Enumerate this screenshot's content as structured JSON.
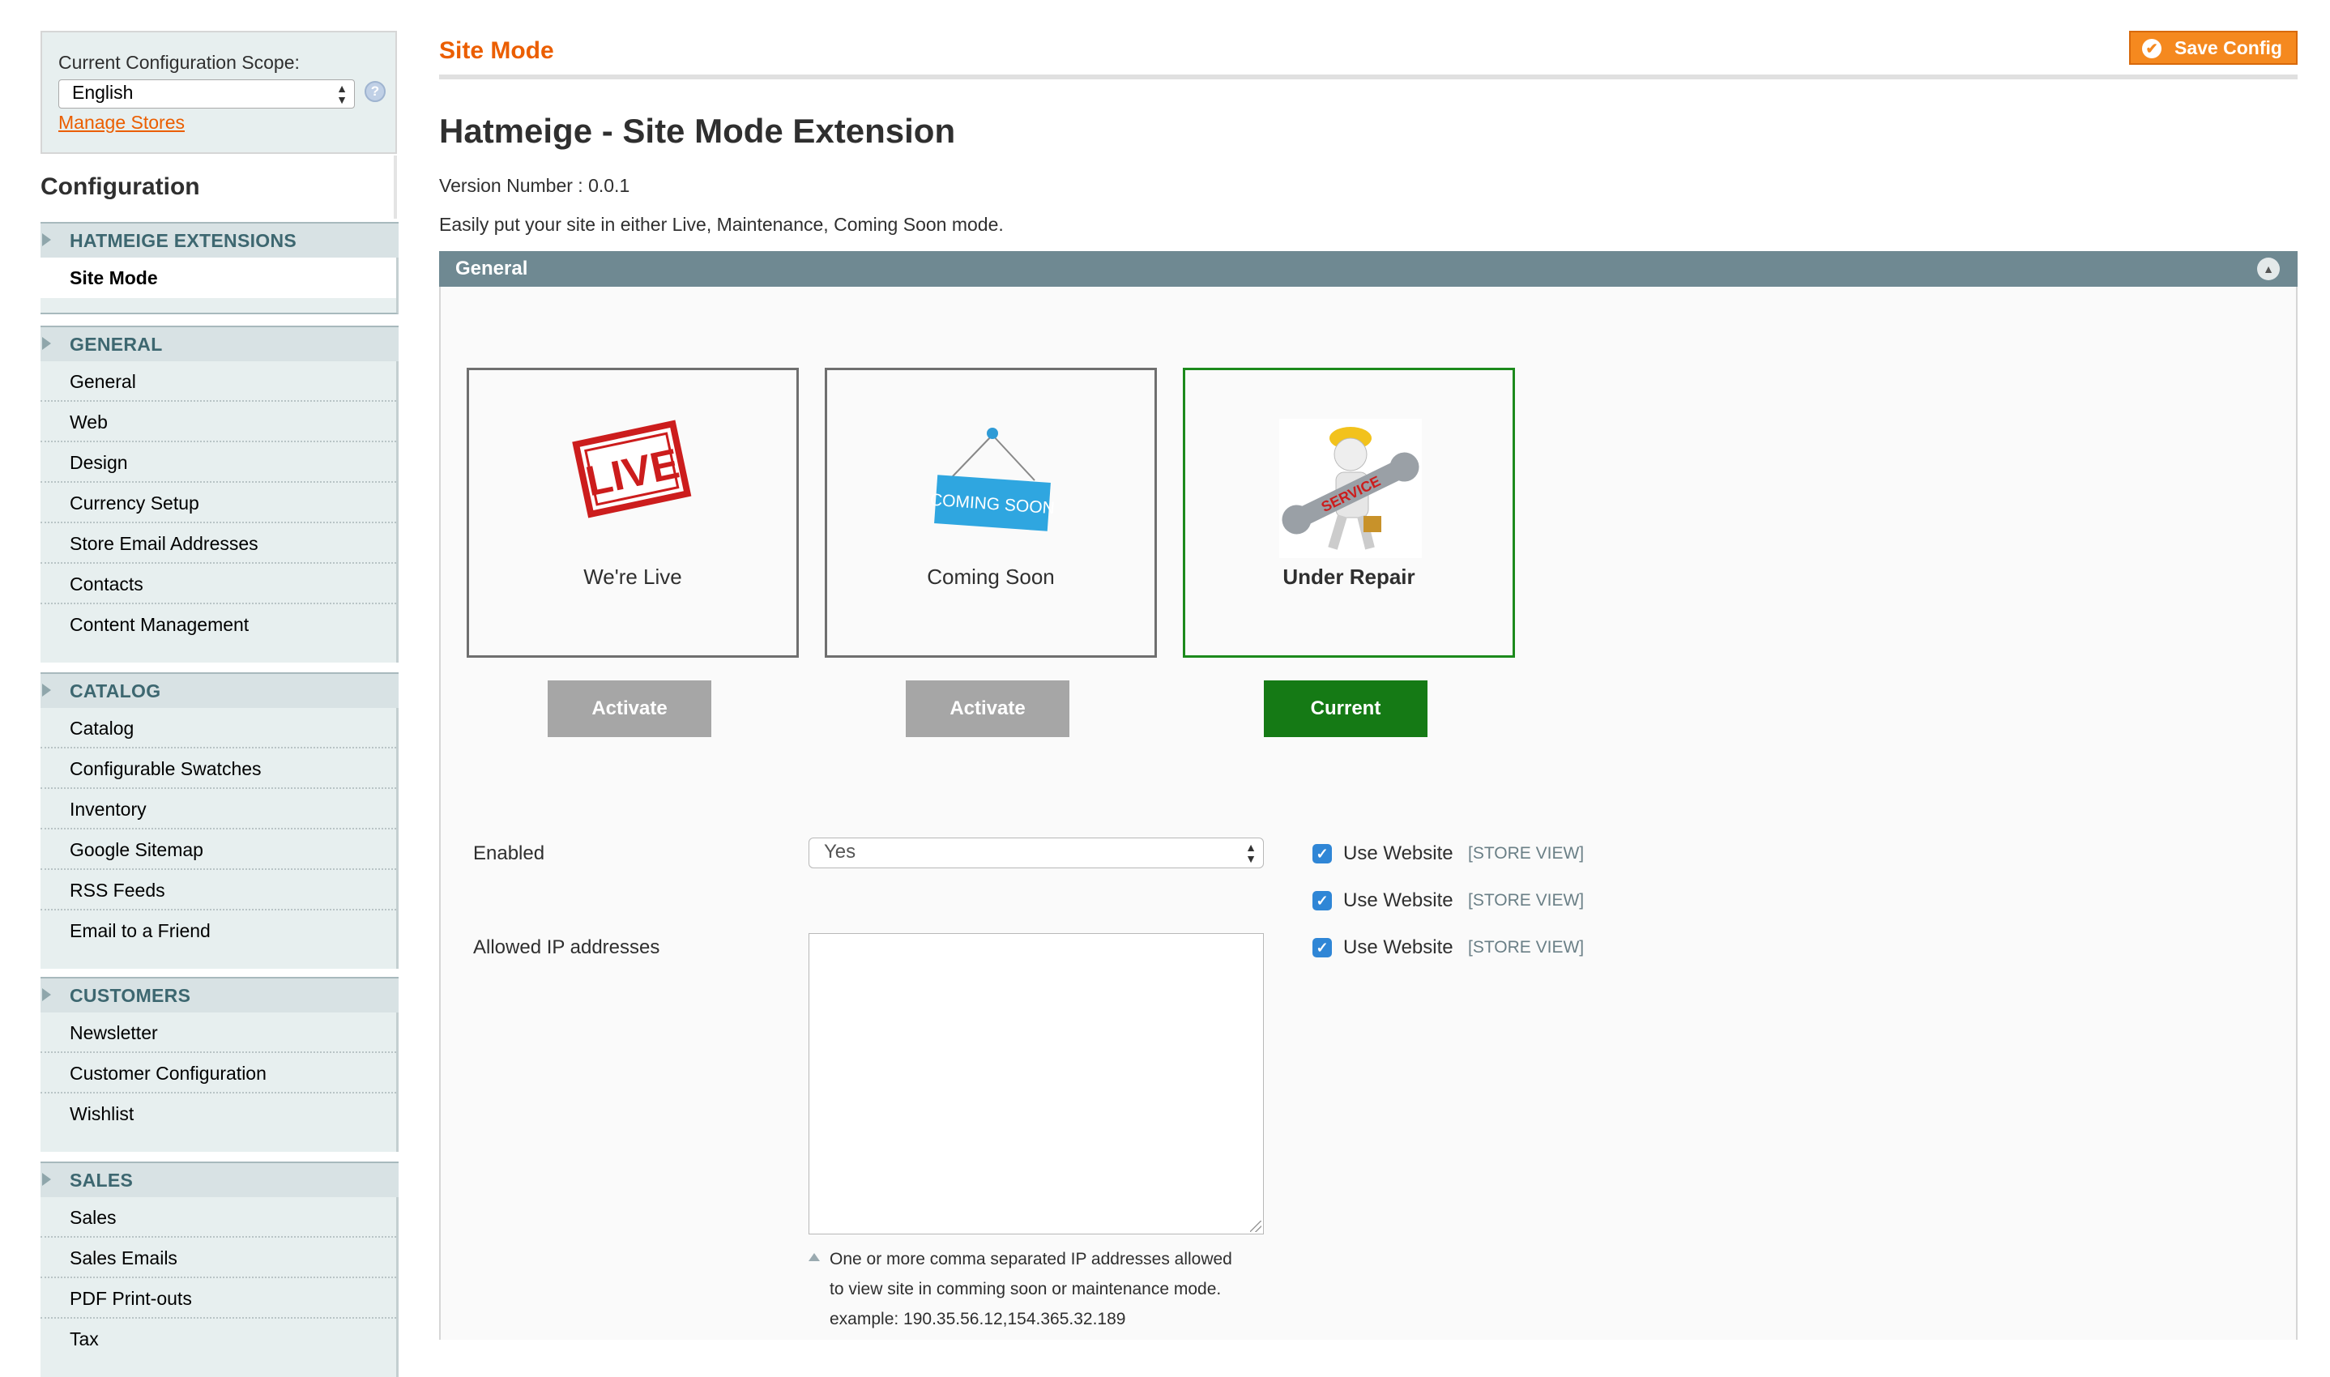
{
  "sidebar": {
    "scope_label": "Current Configuration Scope:",
    "scope_value": "English",
    "manage_stores": "Manage Stores",
    "config_title": "Configuration",
    "groups": [
      {
        "title": "HATMEIGE EXTENSIONS",
        "items": [
          "Site Mode"
        ],
        "active": 0
      },
      {
        "title": "GENERAL",
        "items": [
          "General",
          "Web",
          "Design",
          "Currency Setup",
          "Store Email Addresses",
          "Contacts",
          "Content Management"
        ]
      },
      {
        "title": "CATALOG",
        "items": [
          "Catalog",
          "Configurable Swatches",
          "Inventory",
          "Google Sitemap",
          "RSS Feeds",
          "Email to a Friend"
        ]
      },
      {
        "title": "CUSTOMERS",
        "items": [
          "Newsletter",
          "Customer Configuration",
          "Wishlist"
        ]
      },
      {
        "title": "SALES",
        "items": [
          "Sales",
          "Sales Emails",
          "PDF Print-outs",
          "Tax"
        ]
      }
    ]
  },
  "header": {
    "page_title": "Site Mode",
    "save_button": "Save Config"
  },
  "main": {
    "extension_title": "Hatmeige - Site Mode Extension",
    "version": "Version Number : 0.0.1",
    "description": "Easily put your site in either Live, Maintenance, Coming Soon mode.",
    "section_title": "General",
    "modes": [
      {
        "label": "We're Live",
        "button": "Activate",
        "image_text": "LIVE",
        "current": false
      },
      {
        "label": "Coming Soon",
        "button": "Activate",
        "image_text": "COMING SOON",
        "current": false
      },
      {
        "label": "Under Repair",
        "button": "Current",
        "image_text": "SERVICE",
        "current": true
      }
    ],
    "form": {
      "enabled_label": "Enabled",
      "enabled_value": "Yes",
      "ip_label": "Allowed IP addresses",
      "ip_value": "",
      "ip_note_line1": "One or more comma separated IP addresses allowed",
      "ip_note_line2": "to view site in comming soon or maintenance mode.",
      "ip_note_line3": "example: 190.35.56.12,154.365.32.189",
      "use_website": "Use Website",
      "store_view": "[STORE VIEW]"
    }
  },
  "colors": {
    "accent_orange": "#eb5e00",
    "save_button": "#f5891f",
    "section_bar": "#6f8992",
    "current_green": "#157a15",
    "inactive_button": "#a6a6a6",
    "checkbox_blue": "#2f86d6"
  },
  "icons": [
    "help-icon",
    "checkmark-icon",
    "collapse-arrow-icon",
    "dropdown-arrows-icon",
    "live-stamp-icon",
    "coming-soon-sign-icon",
    "service-worker-icon",
    "resize-grip-icon"
  ]
}
